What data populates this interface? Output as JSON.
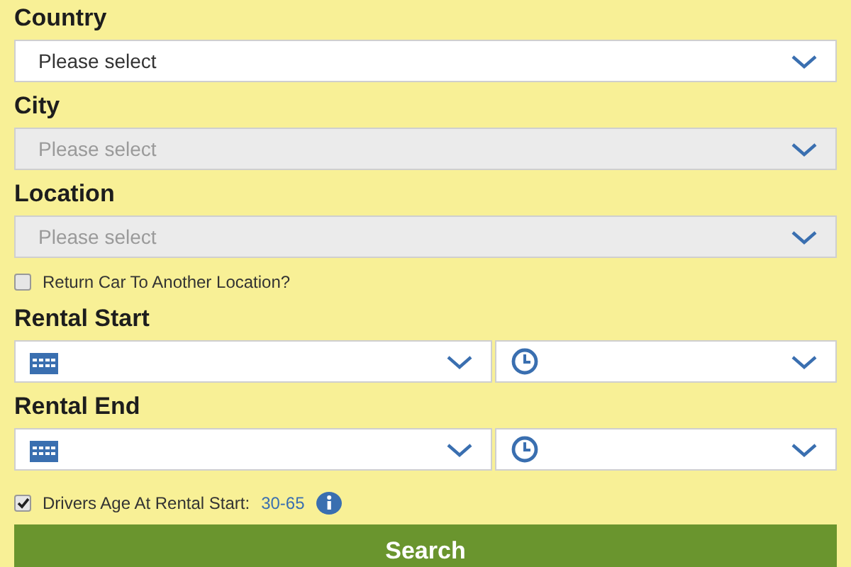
{
  "selects": [
    {
      "label": "Country",
      "placeholder": "Please select",
      "disabled": false
    },
    {
      "label": "City",
      "placeholder": "Please select",
      "disabled": true
    },
    {
      "label": "Location",
      "placeholder": "Please select",
      "disabled": true
    }
  ],
  "return_option": {
    "label": "Return Car To Another Location?",
    "checked": false
  },
  "periods": [
    {
      "label": "Rental Start"
    },
    {
      "label": "Rental End"
    }
  ],
  "age_option": {
    "label": "Drivers Age At Rental Start:",
    "value": "30-65",
    "checked": true
  },
  "search_button": "Search"
}
